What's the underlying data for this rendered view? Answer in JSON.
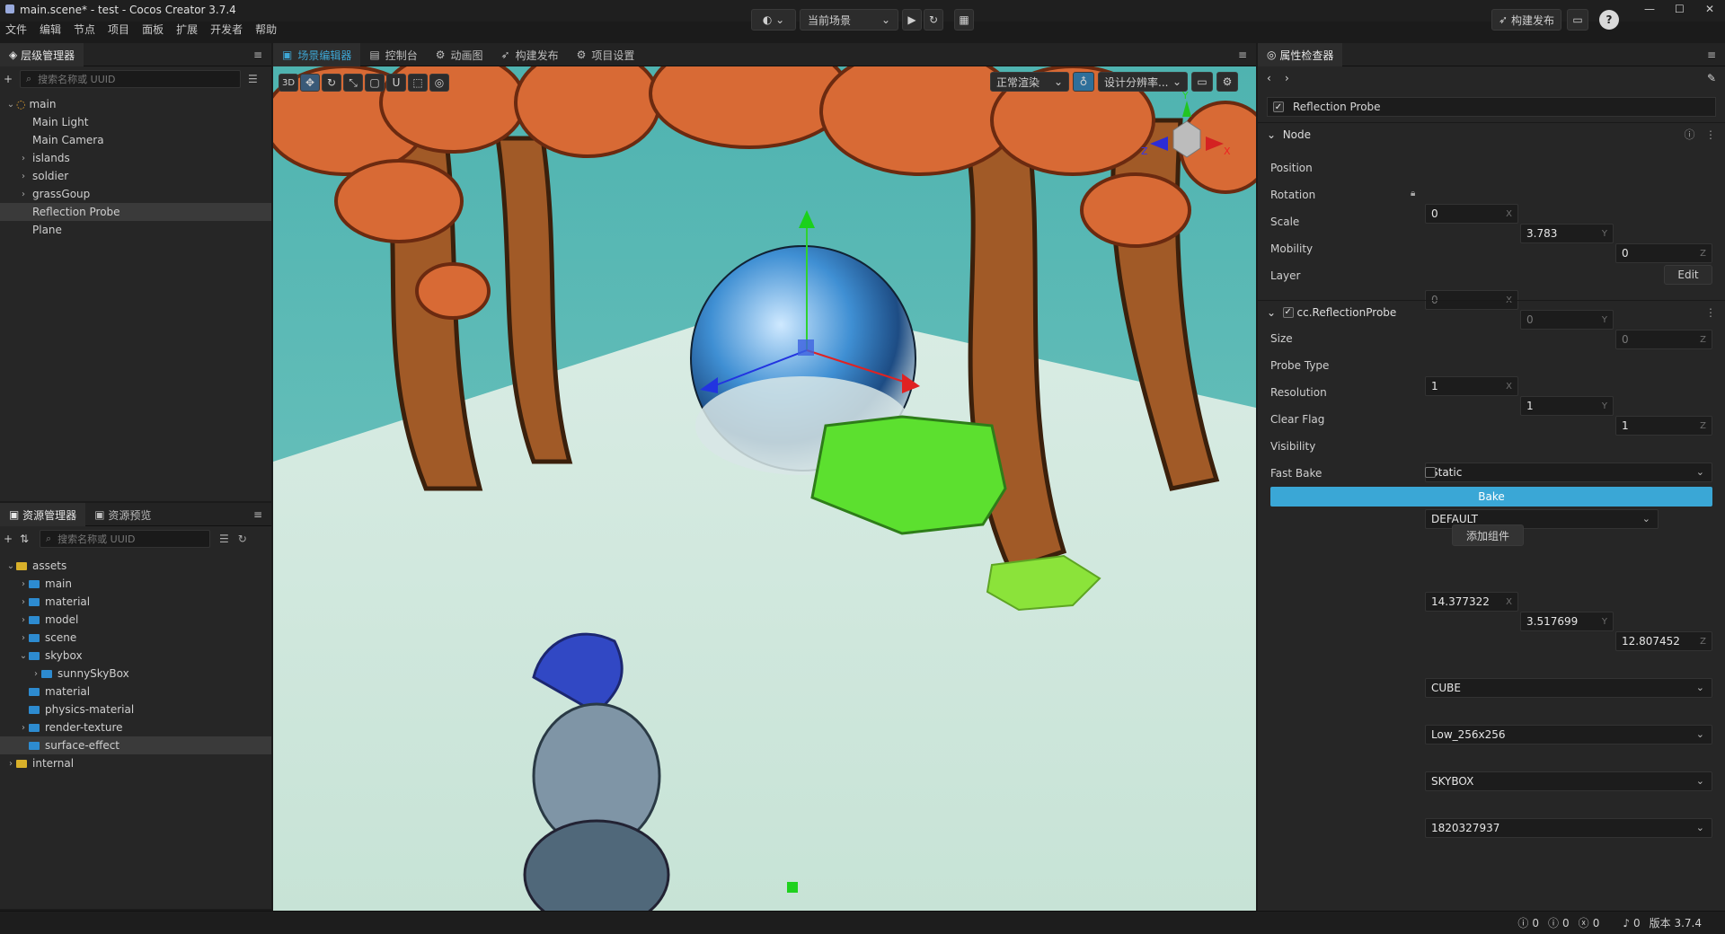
{
  "window": {
    "title": "main.scene* - test - Cocos Creator 3.7.4",
    "min": "—",
    "max": "☐",
    "close": "✕"
  },
  "menu": [
    "文件",
    "编辑",
    "节点",
    "项目",
    "面板",
    "扩展",
    "开发者",
    "帮助"
  ],
  "toolbar": {
    "scene_select": "当前场景",
    "publish": "构建发布"
  },
  "hierarchy": {
    "tab": "层级管理器",
    "search_placeholder": "搜索名称或 UUID",
    "nodes": [
      {
        "label": "main",
        "depth": 0,
        "arrow": "⌄",
        "sel": false
      },
      {
        "label": "Main Light",
        "depth": 1,
        "arrow": "",
        "sel": false
      },
      {
        "label": "Main Camera",
        "depth": 1,
        "arrow": "",
        "sel": false
      },
      {
        "label": "islands",
        "depth": 1,
        "arrow": "›",
        "sel": false
      },
      {
        "label": "soldier",
        "depth": 1,
        "arrow": "›",
        "sel": false
      },
      {
        "label": "grassGoup",
        "depth": 1,
        "arrow": "›",
        "sel": false
      },
      {
        "label": "Reflection Probe",
        "depth": 1,
        "arrow": "",
        "sel": true
      },
      {
        "label": "Plane",
        "depth": 1,
        "arrow": "",
        "sel": false
      }
    ]
  },
  "assets": {
    "tabs": [
      "资源管理器",
      "资源预览"
    ],
    "search_placeholder": "搜索名称或 UUID",
    "items": [
      {
        "label": "assets",
        "depth": 0,
        "arrow": "⌄",
        "sel": false
      },
      {
        "label": "main",
        "depth": 1,
        "arrow": "›",
        "sel": false
      },
      {
        "label": "material",
        "depth": 1,
        "arrow": "›",
        "sel": false
      },
      {
        "label": "model",
        "depth": 1,
        "arrow": "›",
        "sel": false
      },
      {
        "label": "scene",
        "depth": 1,
        "arrow": "›",
        "sel": false
      },
      {
        "label": "skybox",
        "depth": 1,
        "arrow": "⌄",
        "sel": false
      },
      {
        "label": "sunnySkyBox",
        "depth": 2,
        "arrow": "›",
        "sel": false
      },
      {
        "label": "material",
        "depth": 1,
        "arrow": "",
        "sel": false
      },
      {
        "label": "physics-material",
        "depth": 1,
        "arrow": "",
        "sel": false
      },
      {
        "label": "render-texture",
        "depth": 1,
        "arrow": "›",
        "sel": false
      },
      {
        "label": "surface-effect",
        "depth": 1,
        "arrow": "",
        "sel": true
      },
      {
        "label": "internal",
        "depth": 0,
        "arrow": "›",
        "sel": false
      }
    ]
  },
  "center_tabs": [
    "场景编辑器",
    "控制台",
    "动画图",
    "构建发布",
    "项目设置"
  ],
  "scene_toolbar": {
    "mode": "3D",
    "render": "正常渲染",
    "resolution": "设计分辨率..."
  },
  "gizmo": {
    "x": "X",
    "y": "Y",
    "z": "Z"
  },
  "inspector": {
    "tab": "属性检查器",
    "node_name": "Reflection Probe",
    "node_section": "Node",
    "position": {
      "label": "Position",
      "x": "0",
      "y": "3.783",
      "z": "0"
    },
    "rotation": {
      "label": "Rotation",
      "x": "0",
      "y": "0",
      "z": "0"
    },
    "scale": {
      "label": "Scale",
      "x": "1",
      "y": "1",
      "z": "1"
    },
    "mobility": {
      "label": "Mobility",
      "value": "Static"
    },
    "layer": {
      "label": "Layer",
      "value": "DEFAULT",
      "edit": "Edit"
    },
    "component": "cc.ReflectionProbe",
    "size": {
      "label": "Size",
      "x": "14.377322",
      "y": "3.517699",
      "z": "12.807452"
    },
    "probe_type": {
      "label": "Probe Type",
      "value": "CUBE"
    },
    "resolution": {
      "label": "Resolution",
      "value": "Low_256x256"
    },
    "clear_flag": {
      "label": "Clear Flag",
      "value": "SKYBOX"
    },
    "visibility": {
      "label": "Visibility",
      "value": "1820327937"
    },
    "fast_bake": {
      "label": "Fast Bake"
    },
    "bake": "Bake",
    "add_component": "添加组件"
  },
  "status": {
    "info": "0",
    "warn": "0",
    "error": "0",
    "bell": "0",
    "version": "版本 3.7.4"
  },
  "colors": {
    "accent": "#3ea6d4",
    "bake": "#3aa7d6",
    "sel": "#3a3a3a"
  }
}
